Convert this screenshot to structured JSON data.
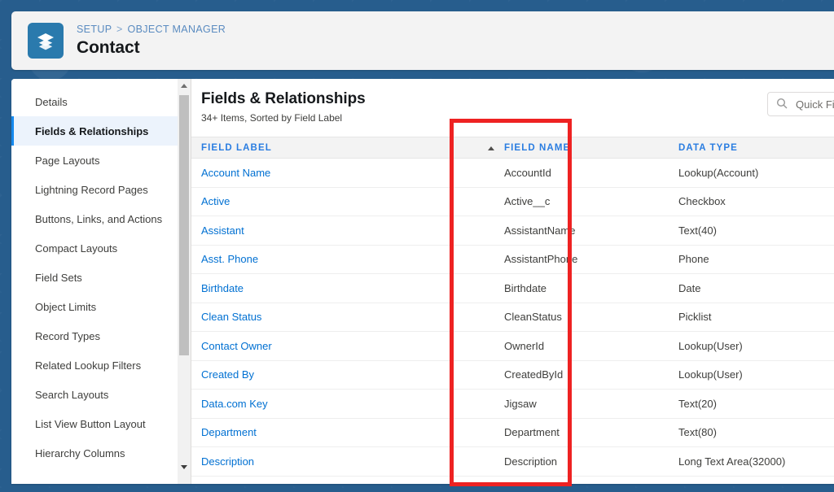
{
  "window": {
    "background_color": "#275d8d"
  },
  "header": {
    "icon": "layers-stack-icon",
    "icon_bg": "#2a7aad",
    "breadcrumb": {
      "setup": "SETUP",
      "separator": ">",
      "object_manager": "OBJECT MANAGER"
    },
    "title": "Contact"
  },
  "sidebar": {
    "items": [
      {
        "label": "Details",
        "active": false
      },
      {
        "label": "Fields & Relationships",
        "active": true
      },
      {
        "label": "Page Layouts",
        "active": false
      },
      {
        "label": "Lightning Record Pages",
        "active": false
      },
      {
        "label": "Buttons, Links, and Actions",
        "active": false
      },
      {
        "label": "Compact Layouts",
        "active": false
      },
      {
        "label": "Field Sets",
        "active": false
      },
      {
        "label": "Object Limits",
        "active": false
      },
      {
        "label": "Record Types",
        "active": false
      },
      {
        "label": "Related Lookup Filters",
        "active": false
      },
      {
        "label": "Search Layouts",
        "active": false
      },
      {
        "label": "List View Button Layout",
        "active": false
      },
      {
        "label": "Hierarchy Columns",
        "active": false
      }
    ],
    "scrollbar": {
      "up_arrow": "scroll-up-arrow",
      "down_arrow": "scroll-down-arrow"
    }
  },
  "main": {
    "title": "Fields & Relationships",
    "subtitle": "34+ Items, Sorted by Field Label",
    "search": {
      "placeholder": "Quick Find",
      "value": "",
      "icon": "search-icon"
    },
    "table": {
      "sort_column": "FIELD LABEL",
      "sort_direction": "ascending",
      "columns": [
        {
          "key": "field_label",
          "label": "FIELD LABEL"
        },
        {
          "key": "field_name",
          "label": "FIELD NAME"
        },
        {
          "key": "data_type",
          "label": "DATA TYPE"
        }
      ],
      "rows": [
        {
          "field_label": "Account Name",
          "field_name": "AccountId",
          "data_type": "Lookup(Account)"
        },
        {
          "field_label": "Active",
          "field_name": "Active__c",
          "data_type": "Checkbox"
        },
        {
          "field_label": "Assistant",
          "field_name": "AssistantName",
          "data_type": "Text(40)"
        },
        {
          "field_label": "Asst. Phone",
          "field_name": "AssistantPhone",
          "data_type": "Phone"
        },
        {
          "field_label": "Birthdate",
          "field_name": "Birthdate",
          "data_type": "Date"
        },
        {
          "field_label": "Clean Status",
          "field_name": "CleanStatus",
          "data_type": "Picklist"
        },
        {
          "field_label": "Contact Owner",
          "field_name": "OwnerId",
          "data_type": "Lookup(User)"
        },
        {
          "field_label": "Created By",
          "field_name": "CreatedById",
          "data_type": "Lookup(User)"
        },
        {
          "field_label": "Data.com Key",
          "field_name": "Jigsaw",
          "data_type": "Text(20)"
        },
        {
          "field_label": "Department",
          "field_name": "Department",
          "data_type": "Text(80)"
        },
        {
          "field_label": "Description",
          "field_name": "Description",
          "data_type": "Long Text Area(32000)"
        }
      ]
    }
  },
  "annotation": {
    "type": "highlight-rectangle",
    "color": "#ee2222",
    "target_column": "FIELD NAME"
  }
}
